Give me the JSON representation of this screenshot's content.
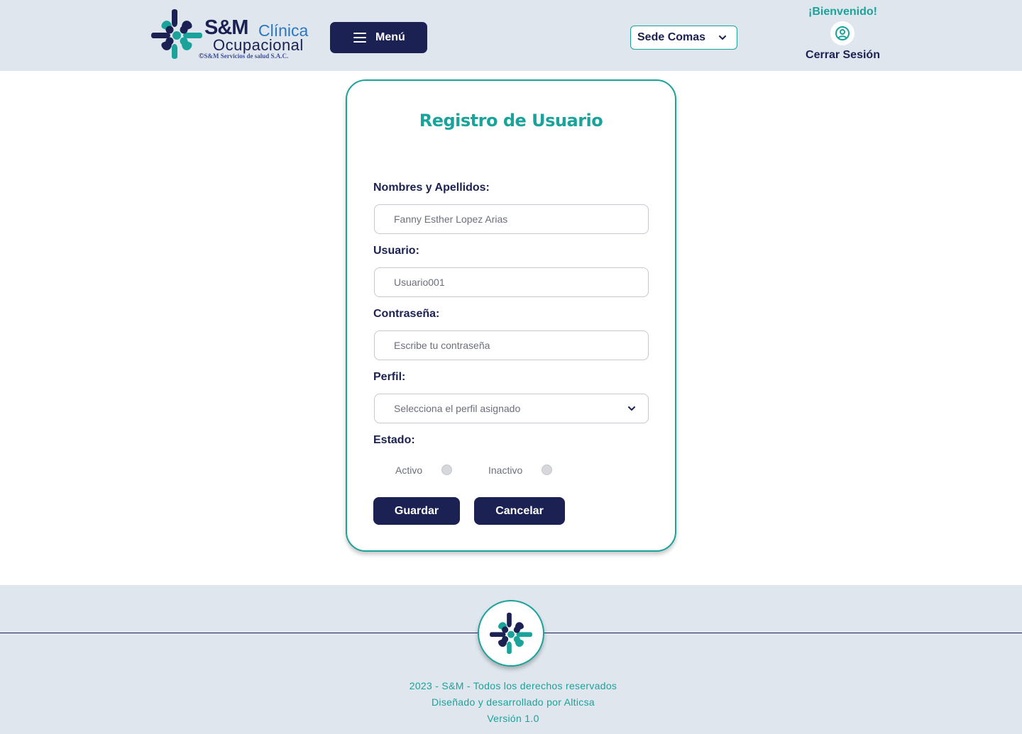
{
  "header": {
    "logo": {
      "brand": "S&M",
      "brand_sub": "Clínica",
      "tagline": "Ocupacional",
      "copyright_symbol": "©",
      "copyright": "S&M Servicios de salud S.A.C."
    },
    "menu_label": "Menú",
    "sede_label": "Sede Comas",
    "welcome": "¡Bienvenido!",
    "logout_label": "Cerrar Sesión"
  },
  "form": {
    "title": "Registro de Usuario",
    "nombres_label": "Nombres y Apellidos:",
    "nombres_value": "Fanny Esther Lopez Arias",
    "usuario_label": "Usuario:",
    "usuario_value": "Usuario001",
    "password_label": "Contraseña:",
    "password_placeholder": "Escribe tu contraseña",
    "perfil_label": "Perfil:",
    "perfil_placeholder": "Selecciona el perfil asignado",
    "estado_label": "Estado:",
    "estado_options": [
      "Activo",
      "Inactivo"
    ],
    "save_label": "Guardar",
    "cancel_label": "Cancelar"
  },
  "footer": {
    "line1": "2023 - S&M - Todos los derechos reservados",
    "line2": "Diseñado y desarrollado por Alticsa",
    "line3": "Versión 1.0"
  },
  "colors": {
    "navy": "#1b2152",
    "teal": "#1aa39a",
    "header_bg": "#dfe6ee",
    "blue": "#2a78c2"
  },
  "icons": [
    "hamburger-icon",
    "chevron-down-icon",
    "user-circle-icon",
    "cross-logo-icon"
  ]
}
